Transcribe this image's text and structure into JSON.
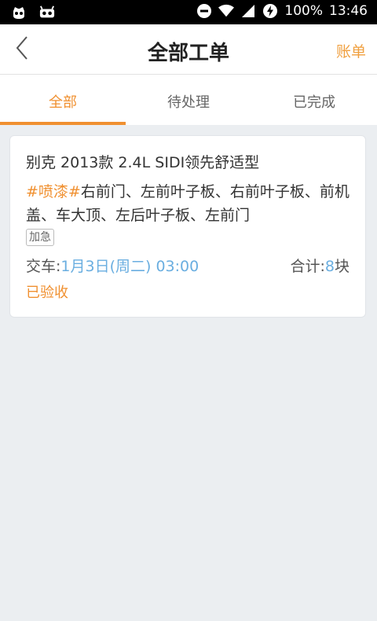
{
  "status_bar": {
    "battery": "100%",
    "time": "13:46"
  },
  "nav": {
    "title": "全部工单",
    "action_label": "账单"
  },
  "tabs": [
    {
      "label": "全部",
      "active": true
    },
    {
      "label": "待处理",
      "active": false
    },
    {
      "label": "已完成",
      "active": false
    }
  ],
  "orders": [
    {
      "car_model": "别克 2013款 2.4L SIDI领先舒适型",
      "service_tag": "#喷漆#",
      "service_items": "右前门、左前叶子板、右前叶子板、前机盖、车大顶、左后叶子板、左前门",
      "urgent_label": "加急",
      "delivery_label": "交车:",
      "delivery_time": "1月3日(周二) 03:00",
      "total_label": "合计:",
      "total_count": "8",
      "total_unit": "块",
      "status": "已验收"
    }
  ],
  "colors": {
    "accent": "#f09030",
    "highlight": "#6aaee0",
    "background": "#ebeef1"
  }
}
